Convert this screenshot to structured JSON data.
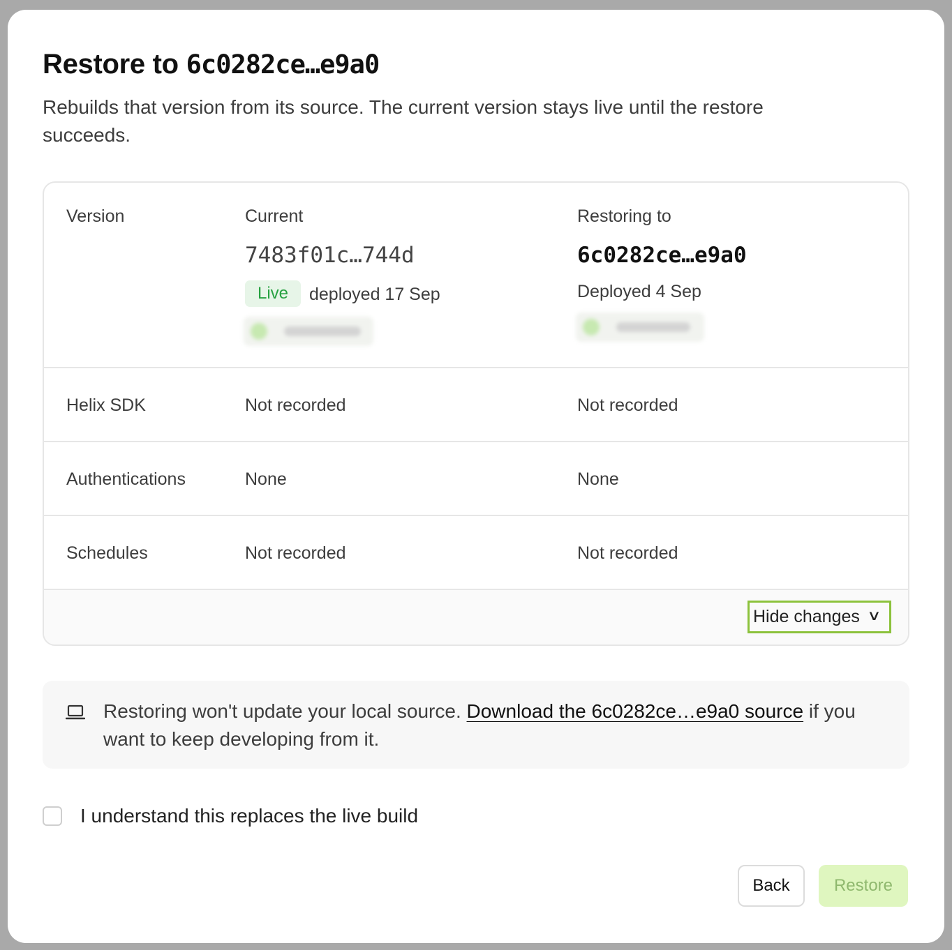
{
  "dialog": {
    "title_prefix": "Restore to ",
    "title_hash": "6c0282ce…e9a0",
    "subtitle": "Rebuilds that version from its source. The current version stays live until the restore succeeds."
  },
  "table": {
    "version_label": "Version",
    "current_header": "Current",
    "target_header": "Restoring to",
    "current_hash": "7483f01c…744d",
    "target_hash": "6c0282ce…e9a0",
    "live_badge": "Live",
    "current_deployed": "deployed 17 Sep",
    "target_deployed": "Deployed 4 Sep",
    "rows": [
      {
        "label": "Helix SDK",
        "current": "Not recorded",
        "target": "Not recorded"
      },
      {
        "label": "Authentications",
        "current": "None",
        "target": "None"
      },
      {
        "label": "Schedules",
        "current": "Not recorded",
        "target": "Not recorded"
      }
    ],
    "toggle_label": "Hide changes"
  },
  "info": {
    "text_before": "Restoring won't update your local source. ",
    "link": "Download the 6c0282ce…e9a0 source",
    "text_after": " if you want to keep developing from it."
  },
  "confirm": {
    "label": "I understand this replaces the live build",
    "checked": false
  },
  "actions": {
    "back": "Back",
    "restore": "Restore"
  },
  "colors": {
    "accent": "#8cc23c",
    "live_text": "#26a140",
    "live_bg": "#e7f5e8",
    "restore_disabled_bg": "#dff6bf"
  }
}
